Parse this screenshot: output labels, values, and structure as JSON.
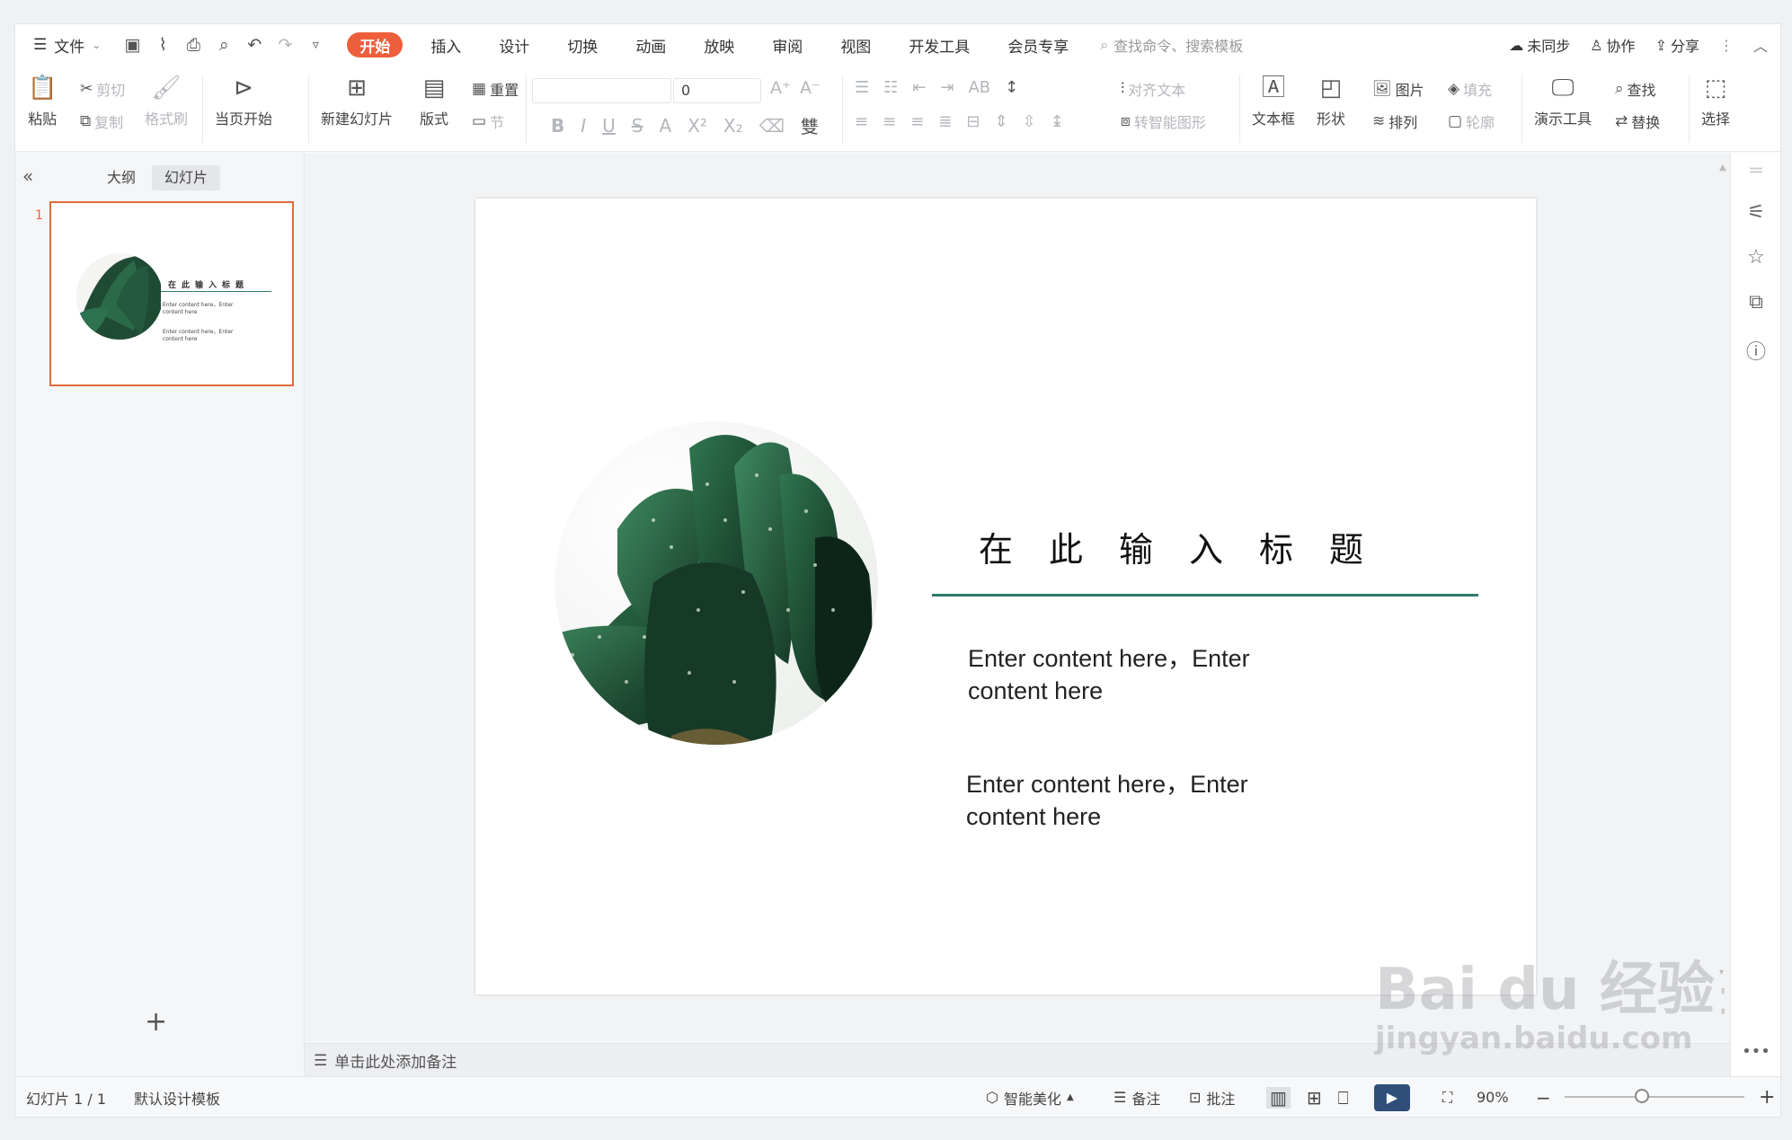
{
  "menubar": {
    "file": "文件",
    "tabs": [
      "开始",
      "插入",
      "设计",
      "切换",
      "动画",
      "放映",
      "审阅",
      "视图",
      "开发工具",
      "会员专享"
    ],
    "search_placeholder": "查找命令、搜索模板",
    "sync": "未同步",
    "collab": "协作",
    "share": "分享"
  },
  "ribbon": {
    "paste": "粘贴",
    "cut": "剪切",
    "copy": "复制",
    "format_painter": "格式刷",
    "start_from_current": "当页开始",
    "new_slide": "新建幻灯片",
    "layout": "版式",
    "reset": "重置",
    "section": "节",
    "font_size": "0",
    "align_text": "对齐文本",
    "smartart": "转智能图形",
    "textbox": "文本框",
    "shape": "形状",
    "picture": "图片",
    "fill": "填充",
    "arrange": "排列",
    "outline": "轮廓",
    "present_tools": "演示工具",
    "find": "查找",
    "replace": "替换",
    "select": "选择"
  },
  "leftpanel": {
    "outline_tab": "大纲",
    "slides_tab": "幻灯片",
    "slide_number": "1"
  },
  "slide": {
    "title": "在此输入标题",
    "body1": "Enter content here，Enter content here",
    "body2": "Enter content here，Enter content here"
  },
  "thumb": {
    "title": "在此输入标题",
    "body1": "Enter content here，Enter content here",
    "body2": "Enter content here，Enter content here"
  },
  "notes": {
    "placeholder": "单击此处添加备注"
  },
  "statusbar": {
    "slide_counter": "幻灯片 1 / 1",
    "template": "默认设计模板",
    "smart_beautify": "智能美化",
    "notes": "备注",
    "comment": "批注",
    "zoom": "90%"
  },
  "watermark": {
    "line1": "Bai du 经验",
    "line2": "jingyan.baidu.com"
  },
  "colors": {
    "accent": "#ed5f3b",
    "title_line": "#2f7a6c",
    "thumb_border": "#e26b3b"
  }
}
